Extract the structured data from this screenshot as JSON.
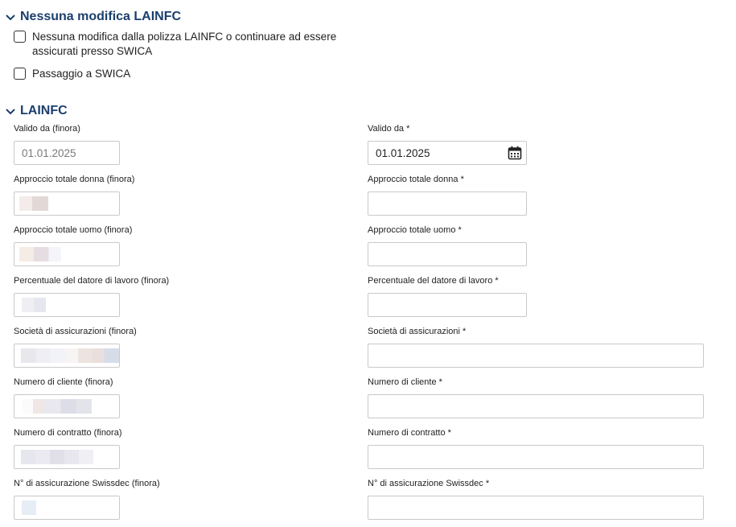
{
  "section_no_change": {
    "title": "Nessuna modifica LAINFC",
    "options": [
      {
        "label": "Nessuna modifica dalla polizza LAINFC o continuare ad essere assicurati presso SWICA",
        "checked": false
      },
      {
        "label": "Passaggio a SWICA",
        "checked": false
      }
    ]
  },
  "section_lainfc": {
    "title": "LAINFC",
    "fields": [
      {
        "old_label": "Valido da (finora)",
        "old_value": "01.01.2025",
        "new_label": "Valido da *",
        "new_value": "01.01.2025"
      },
      {
        "old_label": "Approccio totale donna (finora)",
        "old_value": "",
        "new_label": "Approccio totale donna *",
        "new_value": ""
      },
      {
        "old_label": "Approccio totale uomo (finora)",
        "old_value": "",
        "new_label": "Approccio totale uomo *",
        "new_value": ""
      },
      {
        "old_label": "Percentuale del datore di lavoro (finora)",
        "old_value": "",
        "new_label": "Percentuale del datore di lavoro *",
        "new_value": ""
      },
      {
        "old_label": "Società di assicurazioni (finora)",
        "old_value": "",
        "new_label": "Società di assicurazioni *",
        "new_value": ""
      },
      {
        "old_label": "Numero di cliente (finora)",
        "old_value": "",
        "new_label": "Numero di cliente *",
        "new_value": ""
      },
      {
        "old_label": "Numero di contratto (finora)",
        "old_value": "",
        "new_label": "Numero di contratto *",
        "new_value": ""
      },
      {
        "old_label": "N° di assicurazione Swissdec (finora)",
        "old_value": "",
        "new_label": "N° di assicurazione Swissdec *",
        "new_value": ""
      }
    ]
  },
  "icons": {
    "section_toggle": "chevron-down-icon",
    "date_picker": "calendar-icon"
  },
  "colors": {
    "section_title": "#1b3f6b",
    "input_border": "#c9c9c9",
    "readonly_text": "#7a7a7a"
  }
}
